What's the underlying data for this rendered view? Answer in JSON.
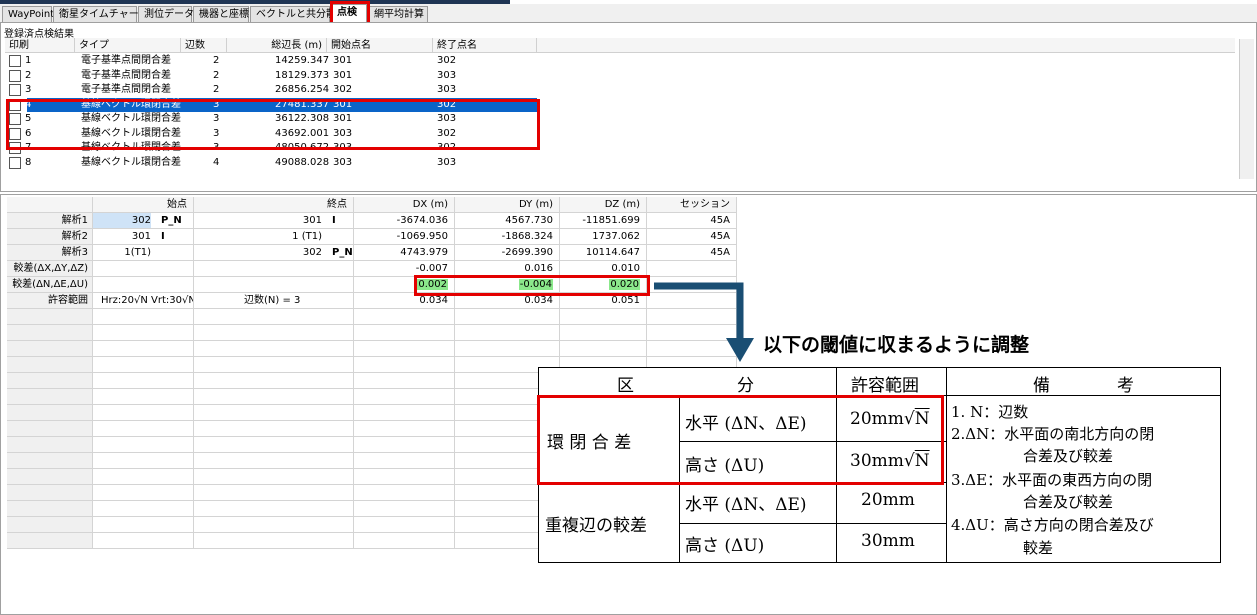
{
  "tabs": [
    {
      "label": "WayPoint"
    },
    {
      "label": "衛星タイムチャート"
    },
    {
      "label": "測位データ"
    },
    {
      "label": "機器と座標"
    },
    {
      "label": "ベクトルと共分散"
    },
    {
      "label": "点検"
    },
    {
      "label": "網平均計算"
    }
  ],
  "results_panel": {
    "title": "登録済点検結果",
    "headers": [
      "印刷",
      "タイプ",
      "辺数",
      "総辺長 (m)",
      "開始点名",
      "終了点名"
    ],
    "rows": [
      {
        "no": "1",
        "type": "電子基準点間閉合差",
        "edges": "2",
        "length": "14259.347",
        "start": "301",
        "end": "302"
      },
      {
        "no": "2",
        "type": "電子基準点間閉合差",
        "edges": "2",
        "length": "18129.373",
        "start": "301",
        "end": "303"
      },
      {
        "no": "3",
        "type": "電子基準点間閉合差",
        "edges": "2",
        "length": "26856.254",
        "start": "302",
        "end": "303"
      },
      {
        "no": "4",
        "type": "基線ベクトル環閉合差",
        "edges": "3",
        "length": "27481.337",
        "start": "301",
        "end": "302"
      },
      {
        "no": "5",
        "type": "基線ベクトル環閉合差",
        "edges": "3",
        "length": "36122.308",
        "start": "301",
        "end": "303"
      },
      {
        "no": "6",
        "type": "基線ベクトル環閉合差",
        "edges": "3",
        "length": "43692.001",
        "start": "303",
        "end": "302"
      },
      {
        "no": "7",
        "type": "基線ベクトル環閉合差",
        "edges": "3",
        "length": "48050.672",
        "start": "303",
        "end": "302"
      },
      {
        "no": "8",
        "type": "基線ベクトル環閉合差",
        "edges": "4",
        "length": "49088.028",
        "start": "303",
        "end": "303"
      }
    ]
  },
  "detail_grid": {
    "headers": [
      "",
      "始点",
      "終点",
      "DX (m)",
      "DY (m)",
      "DZ (m)",
      "セッション"
    ],
    "rows": [
      {
        "label": "解析1",
        "start": "302",
        "start_name": "P_N",
        "end": "301",
        "end_name": "I",
        "dx": "-3674.036",
        "dy": "4567.730",
        "dz": "-11851.699",
        "session": "45A"
      },
      {
        "label": "解析2",
        "start": "301",
        "start_name": "I",
        "end": "1 (T1)",
        "end_name": "",
        "dx": "-1069.950",
        "dy": "-1868.324",
        "dz": "1737.062",
        "session": "45A"
      },
      {
        "label": "解析3",
        "start": "1(T1)",
        "start_name": "",
        "end": "302",
        "end_name": "P_N",
        "dx": "4743.979",
        "dy": "-2699.390",
        "dz": "10114.647",
        "session": "45A"
      },
      {
        "label": "較差(ΔX,ΔY,ΔZ)",
        "start": "",
        "start_name": "",
        "end": "",
        "end_name": "",
        "dx": "-0.007",
        "dy": "0.016",
        "dz": "0.010",
        "session": ""
      },
      {
        "label": "較差(ΔN,ΔE,ΔU)",
        "start": "",
        "start_name": "",
        "end": "",
        "end_name": "",
        "dx": "0.002",
        "dy": "-0.004",
        "dz": "0.020",
        "session": ""
      },
      {
        "label": "許容範囲",
        "start": "Hrz:20√N Vrt:30√N",
        "start_name": "",
        "end": "辺数(N) = 3",
        "end_name": "",
        "dx": "0.034",
        "dy": "0.034",
        "dz": "0.051",
        "session": ""
      }
    ]
  },
  "annotation": "以下の閾値に収まるように調整",
  "reference_table": {
    "headers": {
      "kubun": "区",
      "bun": "分",
      "range": "許容範囲",
      "biko": "備",
      "ko": "考"
    },
    "loop_label": "環 閉 合 差",
    "overlap_label": "重複辺の較差",
    "rows": [
      {
        "sub": "水平 (ΔN、ΔE)",
        "value": "20mm",
        "sqrt": "N"
      },
      {
        "sub": "高さ (ΔU)",
        "value": "30mm",
        "sqrt": "N"
      },
      {
        "sub": "水平 (ΔN、ΔE)",
        "value": "20mm",
        "sqrt": ""
      },
      {
        "sub": "高さ (ΔU)",
        "value": "30mm",
        "sqrt": ""
      }
    ],
    "notes": [
      "1. N：辺数",
      "2.ΔN：水平面の南北方向の閉",
      "合差及び較差",
      "3.ΔE：水平面の東西方向の閉",
      "合差及び較差",
      "4.ΔU：高さ方向の閉合差及び",
      "較差"
    ]
  },
  "colors": {
    "highlight": "#e30000",
    "selection": "#0a64c8",
    "arrow": "#1a4e73",
    "green": "#8be88b"
  }
}
